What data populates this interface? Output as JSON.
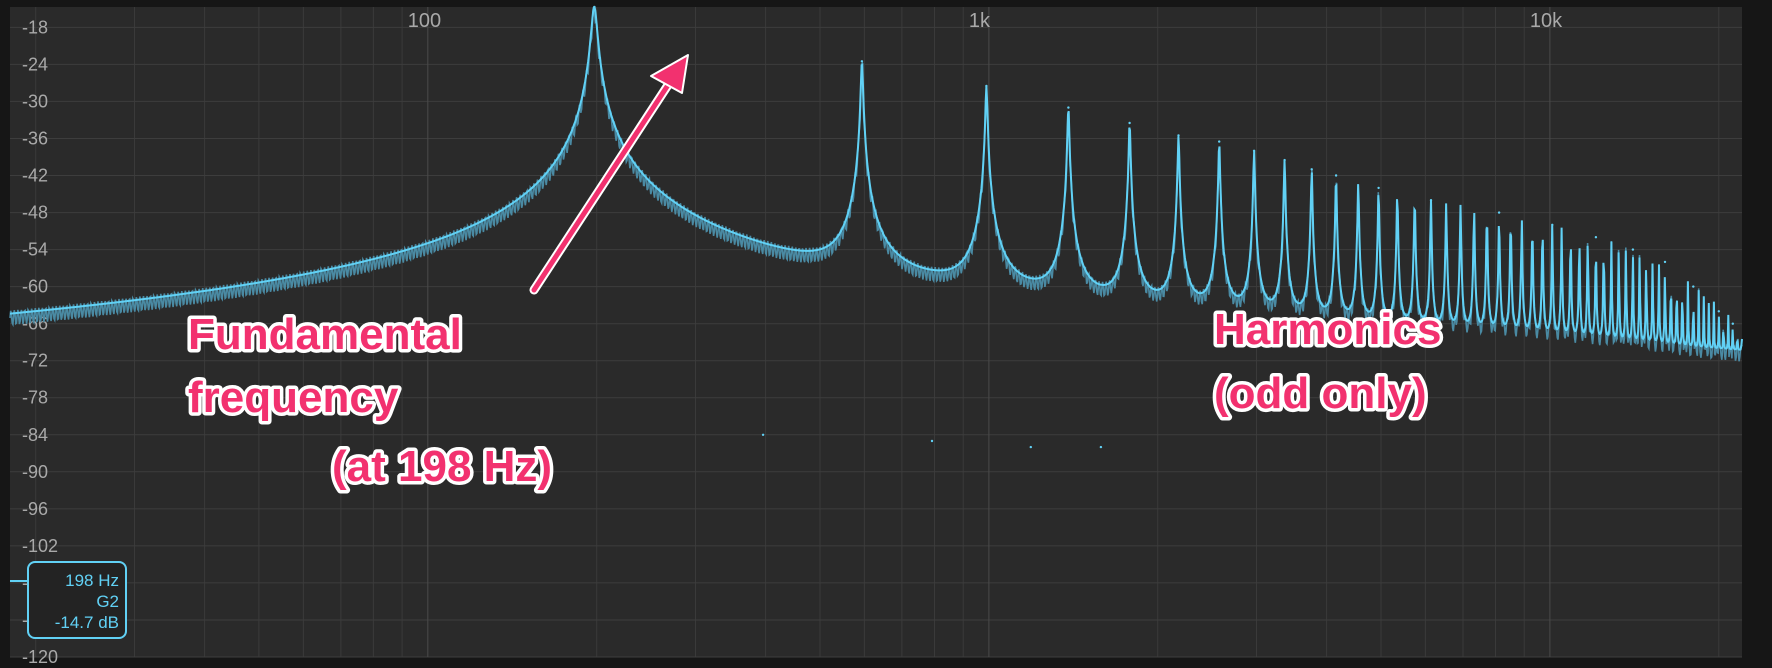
{
  "chart_data": {
    "type": "line",
    "title": "",
    "xlabel": "",
    "ylabel": "",
    "x_scale": "log",
    "xlim": [
      18,
      22000
    ],
    "ylim": [
      -120,
      -14.7
    ],
    "x_tick_labels": [
      {
        "value": 100,
        "label": "100"
      },
      {
        "value": 1000,
        "label": "1k"
      },
      {
        "value": 10000,
        "label": "10k"
      }
    ],
    "y_ticks": [
      -18,
      -24,
      -30,
      -36,
      -42,
      -48,
      -54,
      -60,
      -66,
      -72,
      -78,
      -84,
      -90,
      -96,
      -102,
      -108,
      -114,
      -120
    ],
    "y_tick_labels": [
      "-18",
      "-24",
      "-30",
      "-36",
      "-42",
      "-48",
      "-54",
      "-60",
      "-66",
      "-72",
      "-78",
      "-84",
      "-90",
      "-96",
      "-102",
      "-108",
      "-114",
      "-120"
    ],
    "grid": true,
    "line_color": "#61d1f5",
    "fundamental_hz": 198,
    "peaks": [
      {
        "harmonic": 1,
        "freq_hz": 198,
        "db": -14.7
      },
      {
        "harmonic": 2,
        "freq_hz": 396,
        "db": -84
      },
      {
        "harmonic": 3,
        "freq_hz": 594,
        "db": -23.5
      },
      {
        "harmonic": 4,
        "freq_hz": 792,
        "db": -85
      },
      {
        "harmonic": 5,
        "freq_hz": 990,
        "db": -27.5
      },
      {
        "harmonic": 6,
        "freq_hz": 1188,
        "db": -86
      },
      {
        "harmonic": 7,
        "freq_hz": 1386,
        "db": -31
      },
      {
        "harmonic": 8,
        "freq_hz": 1584,
        "db": -86
      },
      {
        "harmonic": 9,
        "freq_hz": 1782,
        "db": -33.5
      },
      {
        "harmonic": 11,
        "freq_hz": 2178,
        "db": -35.5
      },
      {
        "harmonic": 13,
        "freq_hz": 2574,
        "db": -36.5
      },
      {
        "harmonic": 15,
        "freq_hz": 2970,
        "db": -38
      },
      {
        "harmonic": 17,
        "freq_hz": 3366,
        "db": -39.5
      },
      {
        "harmonic": 19,
        "freq_hz": 3762,
        "db": -41
      },
      {
        "harmonic": 21,
        "freq_hz": 4158,
        "db": -42
      },
      {
        "harmonic": 25,
        "freq_hz": 4950,
        "db": -44
      },
      {
        "harmonic": 31,
        "freq_hz": 6138,
        "db": -46
      },
      {
        "harmonic": 41,
        "freq_hz": 8118,
        "db": -48
      },
      {
        "harmonic": 51,
        "freq_hz": 10098,
        "db": -50
      },
      {
        "harmonic": 61,
        "freq_hz": 12078,
        "db": -52
      },
      {
        "harmonic": 71,
        "freq_hz": 14058,
        "db": -54
      },
      {
        "harmonic": 81,
        "freq_hz": 16038,
        "db": -56
      },
      {
        "harmonic": 91,
        "freq_hz": 18018,
        "db": -60
      },
      {
        "harmonic": 101,
        "freq_hz": 19998,
        "db": -64
      },
      {
        "harmonic": 107,
        "freq_hz": 21186,
        "db": -66
      }
    ]
  },
  "annotations": {
    "fundamental": [
      "Fundamental",
      "frequency",
      "(at 198 Hz)"
    ],
    "harmonics": [
      "Harmonics",
      "(odd only)"
    ]
  },
  "readout": {
    "freq": "198 Hz",
    "note": "G2",
    "level": "-14.7 dB"
  }
}
